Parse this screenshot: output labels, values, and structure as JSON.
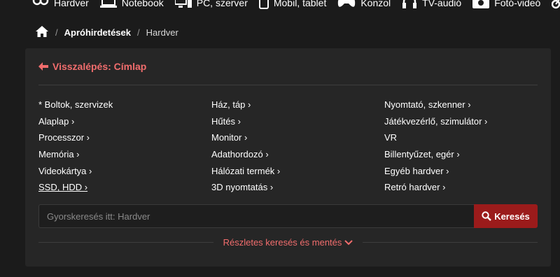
{
  "topnav": {
    "items": [
      {
        "label": "Hardver",
        "icon": "hardware-icon"
      },
      {
        "label": "Notebook",
        "icon": "laptop-icon"
      },
      {
        "label": "PC, szerver",
        "icon": "desktop-icon"
      },
      {
        "label": "Mobil, tablet",
        "icon": "mobile-icon"
      },
      {
        "label": "Konzol",
        "icon": "gamepad-icon"
      },
      {
        "label": "TV-audió",
        "icon": "headphones-icon"
      },
      {
        "label": "Fotó-videó",
        "icon": "camera-icon"
      }
    ]
  },
  "breadcrumb": {
    "home_icon": "home-icon",
    "items": [
      "Apróhirdetések",
      "Hardver"
    ],
    "separator": "/"
  },
  "back": {
    "label": "Visszalépés: Címlap",
    "icon": "arrow-left-icon"
  },
  "categories": {
    "col1": [
      "* Boltok, szervizek",
      "Alaplap ›",
      "Processzor ›",
      "Memória ›",
      "Videokártya ›",
      "SSD, HDD ›"
    ],
    "col2": [
      "Ház, táp ›",
      "Hűtés ›",
      "Monitor ›",
      "Adathordozó ›",
      "Hálózati termék ›",
      "3D nyomtatás ›"
    ],
    "col3": [
      "Nyomtató, szkenner ›",
      "Játékvezérlő, szimulátor ›",
      "VR",
      "Billentyűzet, egér ›",
      "Egyéb hardver ›",
      "Retró hardver ›"
    ]
  },
  "search": {
    "placeholder": "Gyorskeresés itt: Hardver",
    "button_label": "Keresés",
    "button_icon": "search-icon"
  },
  "advanced": {
    "label": "Részletes keresés és mentés",
    "icon": "chevron-down-icon"
  },
  "colors": {
    "accent": "#f16d6d",
    "button": "#9b1b1b",
    "panel": "#262626",
    "background": "#1b1b1b"
  }
}
